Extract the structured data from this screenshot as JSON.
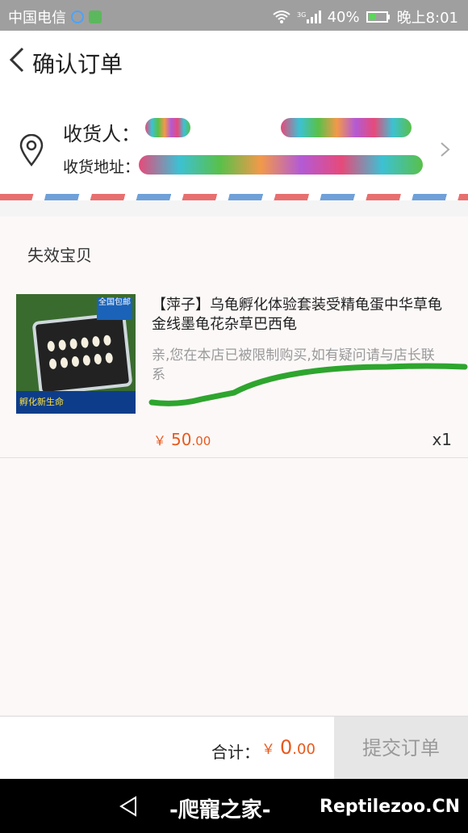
{
  "status_bar": {
    "carrier": "中国电信",
    "battery": "40%",
    "time": "晚上8:01"
  },
  "header": {
    "title": "确认订单"
  },
  "address": {
    "receiver_label": "收货人：",
    "address_label": "收货地址："
  },
  "section": {
    "title": "失效宝贝"
  },
  "product": {
    "name": "【萍子】乌龟孵化体验套装受精龟蛋中华草龟金线墨龟花杂草巴西龟",
    "warning": "亲,您在本店已被限制购买,如有疑问请与店长联系",
    "price_currency": "￥",
    "price_int": "50",
    "price_dec": ".00",
    "quantity": "x1",
    "image_texts": {
      "badge": "全国包邮",
      "banner": "孵化新生命"
    }
  },
  "footer": {
    "total_label": "合计：",
    "total_currency": "￥",
    "total_int": "0",
    "total_dec": ".00",
    "submit_label": "提交订单"
  },
  "system_bar": {
    "watermark_cn": "-爬寵之家-",
    "watermark_en": "Reptilezoo.CN"
  },
  "colors": {
    "accent": "#e8591c",
    "disabled_button": "#e6e6e6",
    "status_bar": "#9f9f9f"
  }
}
